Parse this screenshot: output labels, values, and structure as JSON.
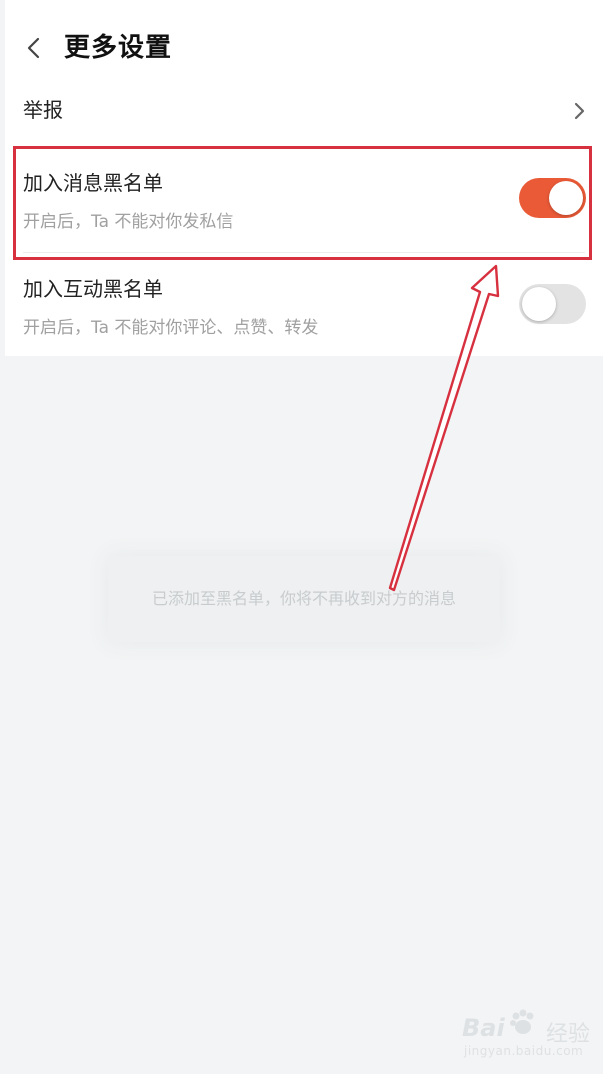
{
  "header": {
    "title": "更多设置",
    "back_icon": "chevron-left-icon"
  },
  "report": {
    "label": "举报",
    "icon": "chevron-right-icon"
  },
  "settings": [
    {
      "title": "加入消息黑名单",
      "subtitle": "开启后，Ta 不能对你发私信",
      "enabled": true
    },
    {
      "title": "加入互动黑名单",
      "subtitle": "开启后，Ta 不能对你评论、点赞、转发",
      "enabled": false
    }
  ],
  "toast": {
    "message": "已添加至黑名单，你将不再收到对方的消息"
  },
  "annotation": {
    "highlight_color": "#d7303f"
  },
  "colors": {
    "toggle_on": "#ea5a37",
    "toggle_off": "#e3e3e3",
    "background": "#f2f4f5"
  },
  "watermark": {
    "logo": "Bai",
    "word": "经验",
    "url": "jingyan.baidu.com"
  }
}
